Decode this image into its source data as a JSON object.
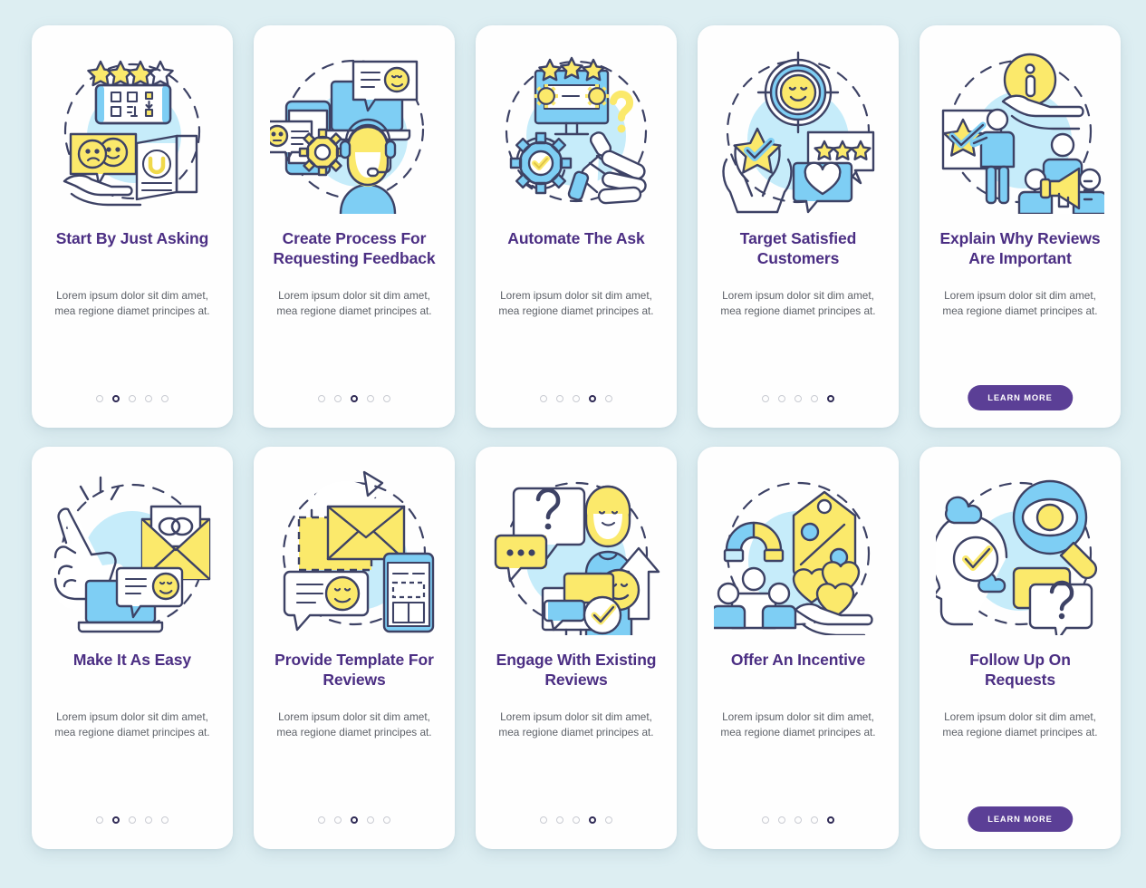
{
  "page": {
    "background_color": "#ddeef2",
    "card_color": "#fefefe",
    "title_color": "#4b2e83",
    "body_color": "#5d6168",
    "accent_button_color": "#5b3f96",
    "dot_active_color": "#2f2a55",
    "dot_inactive_color": "#c9cbd2",
    "illustration_palette": {
      "yellow": "#fbe96b",
      "blue": "#7ecef4",
      "pale_blue": "#c6ecfa",
      "outline": "#3d4265",
      "white": "#ffffff"
    }
  },
  "common": {
    "body_text": "Lorem ipsum dolor sit dim amet, mea regione diamet principes at.",
    "learn_more_label": "LEARN MORE",
    "dot_count": 5
  },
  "screens": [
    {
      "id": "start-by-just-asking",
      "title": "Start By Just Asking",
      "body": "Lorem ipsum dolor sit dim amet, mea regione diamet principes at.",
      "active_dot": 1,
      "has_button": false,
      "illustration": "qr-code-stars-feedback-hand-brochure",
      "illustration_elements": [
        "four-stars",
        "qr-code-card",
        "smiley-sad-speech-bubble",
        "open-hand",
        "magnet-brochure"
      ]
    },
    {
      "id": "create-process-for-requesting-feedback",
      "title": "Create Process For Requesting Feedback",
      "body": "Lorem ipsum dolor sit dim amet, mea regione diamet principes at.",
      "active_dot": 2,
      "has_button": false,
      "illustration": "support-agent-laptop-phone-gear",
      "illustration_elements": [
        "smartphone-chat-bubble",
        "laptop",
        "smiley-speech-bubble",
        "support-agent-headset",
        "gear"
      ]
    },
    {
      "id": "automate-the-ask",
      "title": "Automate The Ask",
      "body": "Lorem ipsum dolor sit dim amet, mea regione diamet principes at.",
      "active_dot": 3,
      "has_button": false,
      "illustration": "monitor-stars-robot-arm-gear-check",
      "illustration_elements": [
        "monitor-with-stars",
        "gears",
        "refresh-gear-checkmark",
        "robot-arm",
        "question-mark"
      ]
    },
    {
      "id": "target-satisfied-customers",
      "title": "Target Satisfied Customers",
      "body": "Lorem ipsum dolor sit dim amet, mea regione diamet principes at.",
      "active_dot": 4,
      "has_button": false,
      "illustration": "target-smiley-hands-star-heart-bubbles",
      "illustration_elements": [
        "target-with-smiley",
        "hands-holding-star-check",
        "stars-speech-bubble",
        "heart-speech-bubble"
      ]
    },
    {
      "id": "explain-why-reviews-are-important",
      "title": "Explain Why Reviews Are Important",
      "body": "Lorem ipsum dolor sit dim amet, mea regione diamet principes at.",
      "active_dot": 0,
      "has_button": true,
      "button_label": "LEARN MORE",
      "illustration": "info-hand-presenter-audience-megaphone",
      "illustration_elements": [
        "info-icon-in-hand",
        "presenter-pointing",
        "whiteboard-with-star",
        "audience-group",
        "megaphone"
      ]
    },
    {
      "id": "make-it-as-easy",
      "title": "Make It As Easy",
      "body": "Lorem ipsum dolor sit dim amet, mea regione diamet principes at.",
      "active_dot": 1,
      "has_button": false,
      "illustration": "click-hand-envelope-link-laptop-smiley",
      "illustration_elements": [
        "pointing-hand-cursor",
        "envelope-with-link",
        "laptop",
        "smiley-speech-bubble"
      ]
    },
    {
      "id": "provide-template-for-reviews",
      "title": "Provide Template For Reviews",
      "body": "Lorem ipsum dolor sit dim amet, mea regione diamet principes at.",
      "active_dot": 2,
      "has_button": false,
      "illustration": "envelope-arrow-template-phone-bubble",
      "illustration_elements": [
        "curved-arrow",
        "yellow-envelope",
        "dashed-template-box",
        "smiley-speech-bubble",
        "phone-template"
      ]
    },
    {
      "id": "engage-with-existing-reviews",
      "title": "Engage With Existing Reviews",
      "body": "Lorem ipsum dolor sit dim amet, mea regione diamet principes at.",
      "active_dot": 3,
      "has_button": false,
      "illustration": "woman-question-bubbles-monitor-check-arrow",
      "illustration_elements": [
        "question-speech-bubble",
        "ellipsis-speech-bubble",
        "woman-figure",
        "smiley-face",
        "up-arrow",
        "monitor-with-chat",
        "checkmark"
      ]
    },
    {
      "id": "offer-an-incentive",
      "title": "Offer An Incentive",
      "body": "Lorem ipsum dolor sit dim amet, mea regione diamet principes at.",
      "active_dot": 4,
      "has_button": false,
      "illustration": "magnet-discount-tag-group-hearts-hand",
      "illustration_elements": [
        "magnet",
        "percent-discount-tag",
        "people-group",
        "hearts-in-hand"
      ]
    },
    {
      "id": "follow-up-on-requests",
      "title": "Follow Up On Requests",
      "body": "Lorem ipsum dolor sit dim amet, mea regione diamet principes at.",
      "active_dot": 0,
      "has_button": true,
      "button_label": "LEARN MORE",
      "illustration": "head-profile-check-magnifier-eye-question",
      "illustration_elements": [
        "head-profile",
        "checkmark-circle",
        "clouds",
        "magnifier-with-eye",
        "question-speech-bubbles"
      ]
    }
  ]
}
